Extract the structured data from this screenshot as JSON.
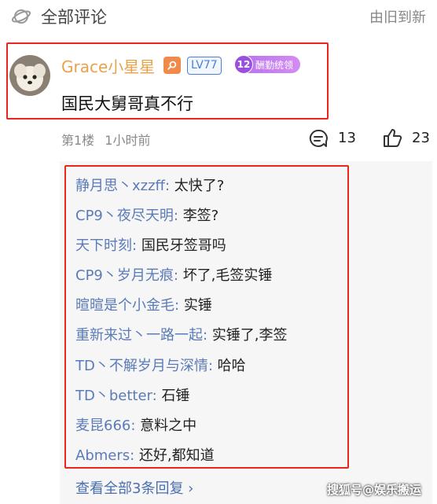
{
  "header": {
    "title": "全部评论",
    "sort_label": "由旧到新"
  },
  "comment": {
    "username": "Grace小星星",
    "level": "LV77",
    "fan_badge": {
      "level": "12",
      "text": "酬勤统领"
    },
    "text": "国民大舅哥真不行",
    "floor": "第1楼",
    "time": "1小时前",
    "reply_count": "13",
    "like_count": "23"
  },
  "replies": [
    {
      "name": "静月思丶xzzff:",
      "text": "太快了?"
    },
    {
      "name": "CP9丶夜尽天明:",
      "text": "李签?"
    },
    {
      "name": "天下时刻:",
      "text": "国民牙签哥吗"
    },
    {
      "name": "CP9丶岁月无痕:",
      "text": "坏了,毛签实锤"
    },
    {
      "name": "暄暄是个小金毛:",
      "text": "实锤"
    },
    {
      "name": "重新来过丶一路一起:",
      "text": "实锤了,李签"
    },
    {
      "name": "TD丶不解岁月与深情:",
      "text": "哈哈"
    },
    {
      "name": "TD丶better:",
      "text": "石锤"
    },
    {
      "name": "麦昆666:",
      "text": "意料之中"
    },
    {
      "name": "Abmers:",
      "text": "还好,都知道"
    }
  ],
  "view_all_label": "查看全部3条回复 ›",
  "watermark": "搜狐号@娱乐搬运",
  "colors": {
    "highlight_border": "#e8281e",
    "username": "#e8a24a",
    "reply_name": "#5b7bb8",
    "link": "#4a6fb0"
  }
}
